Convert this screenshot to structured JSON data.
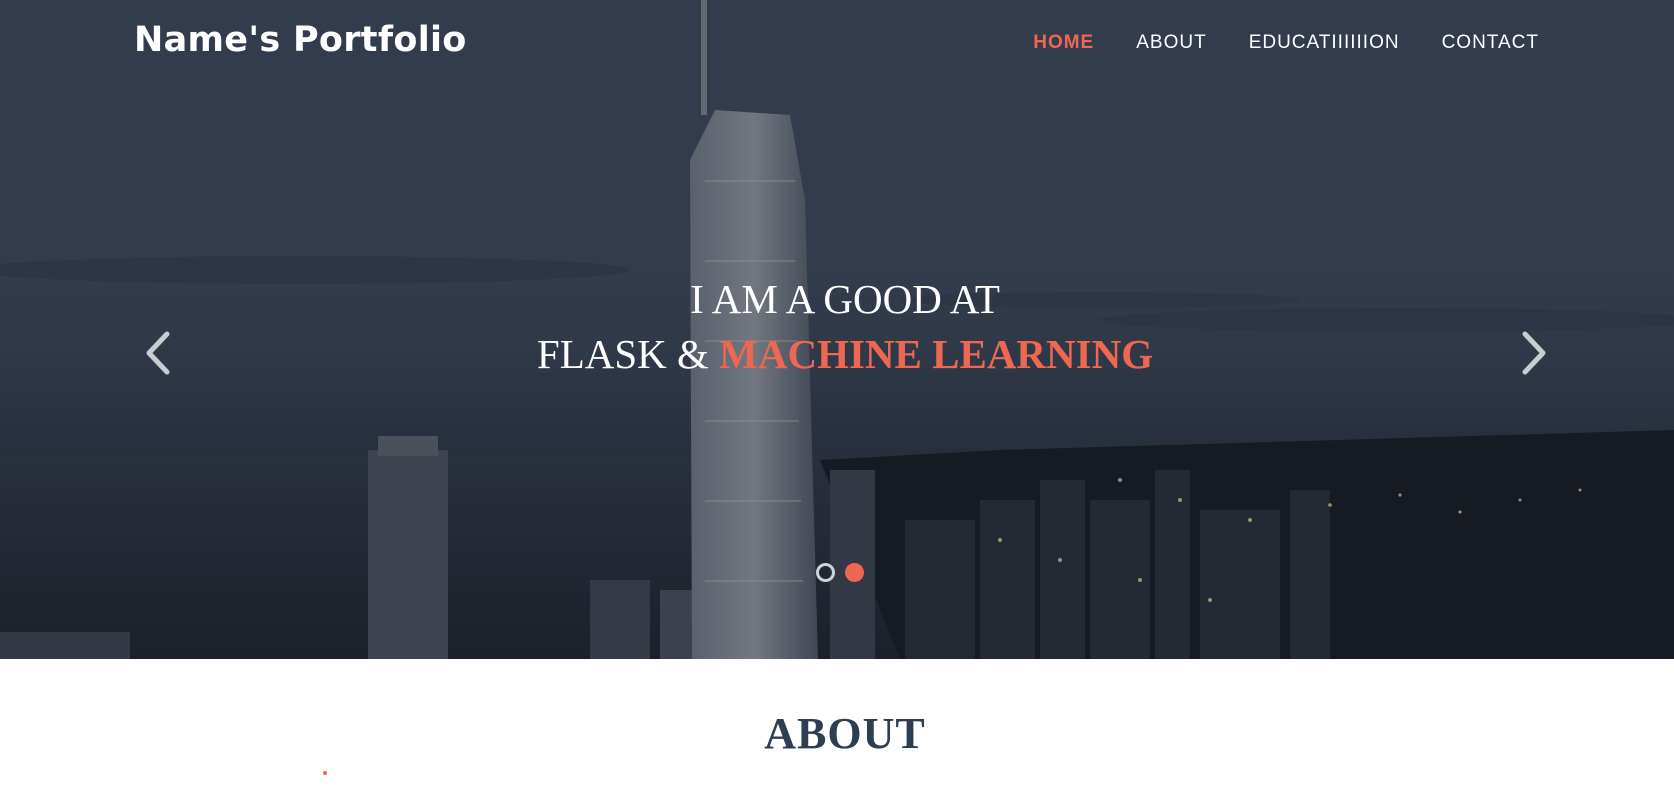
{
  "navbar": {
    "brand": "Name's Portfolio",
    "links": [
      {
        "label": "HOME",
        "active": true
      },
      {
        "label": "ABOUT",
        "active": false
      },
      {
        "label": "EDUCATIIIIIION",
        "active": false
      },
      {
        "label": "CONTACT",
        "active": false
      }
    ]
  },
  "hero": {
    "line1": "I AM A GOOD AT",
    "line2_prefix": "FLASK & ",
    "line2_accent": "MACHINE LEARNING",
    "prev_icon": "chevron-left-icon",
    "next_icon": "chevron-right-icon",
    "slides": [
      {
        "active": false
      },
      {
        "active": true
      }
    ]
  },
  "about": {
    "heading": "ABOUT"
  },
  "colors": {
    "accent": "#ee6751",
    "heading": "#2c3e50",
    "nav_text": "#ffffff"
  }
}
